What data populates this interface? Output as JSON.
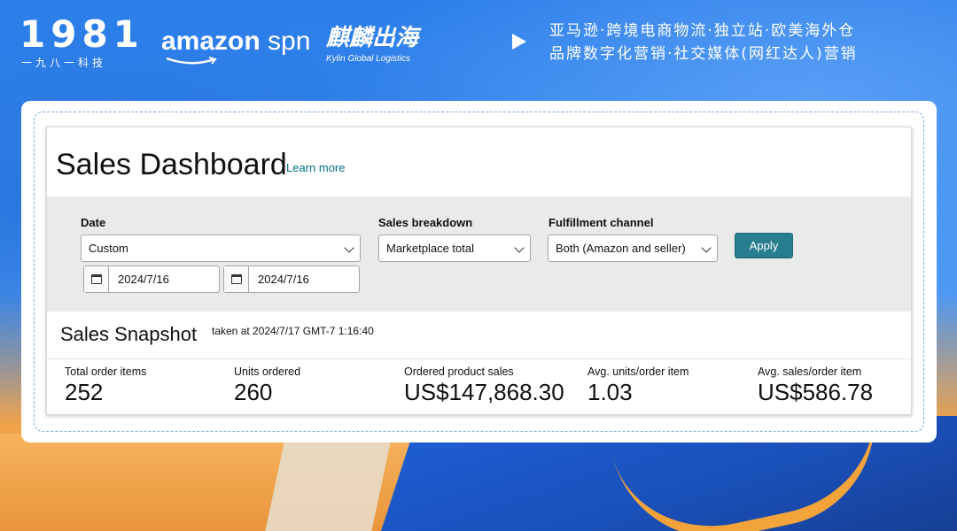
{
  "header": {
    "logo_1981_number": "1981",
    "logo_1981_sub": "一九八一科技",
    "logo_amazon": "amazon",
    "logo_spn": "spn",
    "logo_kylin_cn": "麒麟出海",
    "logo_kylin_en": "Kylin Global Logistics",
    "tagline_line1": "亚马逊·跨境电商物流·独立站·欧美海外仓",
    "tagline_line2": "品牌数字化营销·社交媒体(网红达人)营销"
  },
  "dashboard": {
    "title": "Sales Dashboard",
    "learn_more": "Learn more",
    "filters": {
      "date_label": "Date",
      "date_value": "Custom",
      "start_date": "2024/7/16",
      "end_date": "2024/7/16",
      "breakdown_label": "Sales breakdown",
      "breakdown_value": "Marketplace total",
      "channel_label": "Fulfillment channel",
      "channel_value": "Both (Amazon and seller)",
      "apply_label": "Apply"
    },
    "snapshot": {
      "title": "Sales Snapshot",
      "taken_at": "taken at 2024/7/17 GMT-7 1:16:40",
      "metrics": [
        {
          "label": "Total order items",
          "value": "252"
        },
        {
          "label": "Units ordered",
          "value": "260"
        },
        {
          "label": "Ordered product sales",
          "value": "US$147,868.30"
        },
        {
          "label": "Avg. units/order item",
          "value": "1.03"
        },
        {
          "label": "Avg. sales/order item",
          "value": "US$586.78"
        }
      ]
    }
  },
  "colors": {
    "accent": "#287e8f",
    "link": "#007185",
    "filter_bg": "#e9eaea"
  }
}
